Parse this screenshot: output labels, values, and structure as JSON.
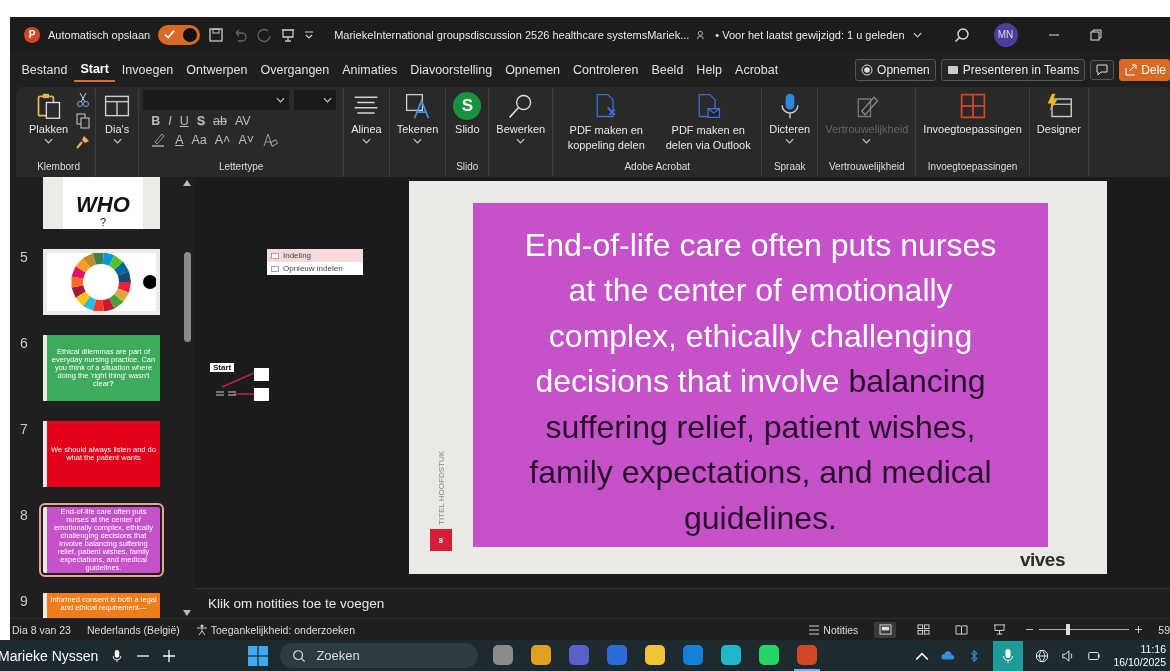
{
  "title_bar": {
    "app_letter": "P",
    "autosave_label": "Automatisch opslaan",
    "autosave_on": true,
    "document_title": "MariekeInternational groupsdiscussion 2526 healthcare systemsMariek...",
    "last_modified": "• Voor het laatst gewijzigd: 1 u geleden",
    "avatar": "MN"
  },
  "menu_tabs": [
    {
      "label": "Bestand",
      "selected": false
    },
    {
      "label": "Start",
      "selected": true
    },
    {
      "label": "Invoegen",
      "selected": false
    },
    {
      "label": "Ontwerpen",
      "selected": false
    },
    {
      "label": "Overgangen",
      "selected": false
    },
    {
      "label": "Animaties",
      "selected": false
    },
    {
      "label": "Diavoorstelling",
      "selected": false
    },
    {
      "label": "Opnemen",
      "selected": false
    },
    {
      "label": "Controleren",
      "selected": false
    },
    {
      "label": "Beeld",
      "selected": false
    },
    {
      "label": "Help",
      "selected": false
    },
    {
      "label": "Acrobat",
      "selected": false
    }
  ],
  "menu_actions": [
    {
      "kind": "record",
      "label": "Opnemen"
    },
    {
      "kind": "teams",
      "label": "Presenteren in Teams"
    },
    {
      "kind": "comments"
    },
    {
      "kind": "share",
      "label": "Dele"
    }
  ],
  "ribbon": [
    {
      "kind": "clipboard",
      "label": "Klembord",
      "buttons": [
        {
          "kind": "paste",
          "label": "Plakken",
          "dropdown": true,
          "disabled": false
        }
      ]
    },
    {
      "kind": "buttons",
      "buttons": [
        {
          "kind": "slides",
          "label": "Dia's",
          "dropdown": true,
          "disabled": false
        }
      ]
    },
    {
      "kind": "font",
      "label": "Lettertype",
      "format_buttons": [
        "B",
        "I",
        "U",
        "S",
        "ab",
        "AV"
      ],
      "style_buttons": [
        "A",
        "Aa",
        "A˄",
        "A˅"
      ]
    },
    {
      "kind": "buttons",
      "buttons": [
        {
          "kind": "paragraph",
          "label": "Alinea",
          "dropdown": true,
          "disabled": false
        }
      ]
    },
    {
      "kind": "buttons",
      "buttons": [
        {
          "kind": "draw",
          "label": "Tekenen",
          "dropdown": true,
          "disabled": false
        }
      ]
    },
    {
      "kind": "buttons",
      "label": "Slido",
      "buttons": [
        {
          "kind": "slido",
          "label": "Slido",
          "icon_text": "S",
          "dropdown": false,
          "disabled": false
        }
      ]
    },
    {
      "kind": "buttons",
      "buttons": [
        {
          "kind": "edit",
          "label": "Bewerken",
          "dropdown": true,
          "disabled": false
        }
      ]
    },
    {
      "kind": "buttons",
      "label": "Adobe Acrobat",
      "buttons": [
        {
          "kind": "pdf-link",
          "label": "PDF maken en koppeling delen",
          "dropdown": false,
          "disabled": false
        },
        {
          "kind": "pdf-mail",
          "label": "PDF maken en delen via Outlook",
          "dropdown": false,
          "disabled": false
        }
      ]
    },
    {
      "kind": "buttons",
      "label": "Spraak",
      "buttons": [
        {
          "kind": "dictate",
          "label": "Dicteren",
          "dropdown": true,
          "disabled": false
        }
      ]
    },
    {
      "kind": "buttons",
      "label": "Vertrouwelijkheid",
      "buttons": [
        {
          "kind": "sensitivity",
          "label": "Vertrouwelijkheid",
          "dropdown": true,
          "disabled": true
        }
      ]
    },
    {
      "kind": "buttons",
      "label": "Invoegtoepassingen",
      "buttons": [
        {
          "kind": "addins",
          "label": "Invoegtoepassingen",
          "dropdown": false,
          "disabled": false
        }
      ]
    },
    {
      "kind": "buttons",
      "buttons": [
        {
          "kind": "designer",
          "label": "Designer",
          "dropdown": false,
          "disabled": false
        }
      ]
    }
  ],
  "thumbnails": [
    {
      "kind": "title",
      "lines": [
        "WHO",
        "?"
      ],
      "selected": false
    },
    {
      "kind": "picture",
      "number": "5",
      "selected": false
    },
    {
      "kind": "text",
      "number": "6",
      "color": "#3daa5c",
      "text": "Ethical dilemmas are part of everyday nursing practice. Can you think of a situation where doing the 'right thing' wasn't clear**?**",
      "selected": false
    },
    {
      "kind": "text",
      "number": "7",
      "color": "#e3001b",
      "text": "We should always listen and do what the patient wants",
      "selected": false
    },
    {
      "kind": "text",
      "number": "8",
      "color": "#c552c9",
      "text": "End-of-life care often puts nurses at the center of emotionally complex, ethically challenging decisions that involve balancing suffering relief, patient wishes, family expectations, and medical guidelines.",
      "selected": true
    },
    {
      "kind": "text",
      "number": "9",
      "color": "#f07d1a",
      "text": "Informed consent is both a legal and ethical requirement—",
      "selected": false
    }
  ],
  "popup_menu": [
    {
      "label": "Indeling",
      "selected": true
    },
    {
      "label": "Opnieuw indelen",
      "selected": false
    }
  ],
  "flow_label": "Start",
  "slide": {
    "lines": [
      [
        {
          "text": "End-of-life care often puts nurses",
          "dark": false
        }
      ],
      [
        {
          "text": "at the center of emotionally",
          "dark": false
        }
      ],
      [
        {
          "text": "complex, ethically challenging",
          "dark": false
        }
      ],
      [
        {
          "text": "decisions that involve ",
          "dark": false
        },
        {
          "text": "balancing",
          "dark": true
        }
      ],
      [
        {
          "text": "suffering relief, patient wishes,",
          "dark": true
        }
      ],
      [
        {
          "text": "family expectations, and medical",
          "dark": true
        }
      ],
      [
        {
          "text": "guidelines.",
          "dark": true
        }
      ]
    ],
    "side_label": "TITEL HOOFDSTUK",
    "number": "8",
    "logo": "vives"
  },
  "notes_placeholder": "Klik om notities toe te voegen",
  "status_bar": {
    "slide_counter": "Dia 8 van 23",
    "language": "Nederlands (België)",
    "accessibility": "Toegankelijkheid: onderzoeken",
    "notes_button": "Notities",
    "views": [
      {
        "kind": "normal",
        "selected": true
      },
      {
        "kind": "sorter",
        "selected": false
      },
      {
        "kind": "reading",
        "selected": false
      },
      {
        "kind": "slideshow",
        "selected": false
      }
    ],
    "zoom": {
      "level": 0.3,
      "reading": "59"
    }
  },
  "taskbar": {
    "caller": "Marieke Nyssen",
    "search_placeholder": "Zoeken",
    "apps": [
      {
        "kind": "files",
        "active": false
      },
      {
        "kind": "chrome",
        "active": false
      },
      {
        "kind": "teams",
        "active": false
      },
      {
        "kind": "word",
        "active": false
      },
      {
        "kind": "explorer",
        "active": false
      },
      {
        "kind": "outlook",
        "active": false
      },
      {
        "kind": "canva",
        "active": false
      },
      {
        "kind": "whatsapp",
        "active": false
      },
      {
        "kind": "powerpoint",
        "active": true
      }
    ],
    "mic_on": true,
    "time": "11:16",
    "date": "16/10/2025"
  }
}
